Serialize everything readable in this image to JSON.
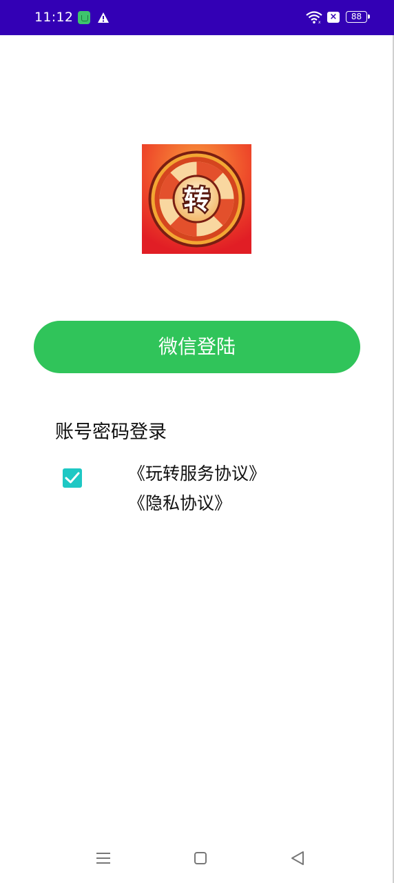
{
  "status_bar": {
    "time": "11:12",
    "battery": "88",
    "icons": [
      "app-notification-icon",
      "warning-icon",
      "wifi-icon",
      "no-sim-icon",
      "battery-icon"
    ]
  },
  "logo": {
    "character": "转",
    "colors": {
      "background": "#e8392a",
      "ring": "#f0a030",
      "center": "#f6d6a8"
    }
  },
  "login": {
    "wechat_button": "微信登陆",
    "account_login": "账号密码登录"
  },
  "agreement": {
    "checked": true,
    "terms": "《玩转服务协议》",
    "privacy": "《隐私协议》"
  },
  "colors": {
    "status_bar": "#3300b5",
    "primary_button": "#30c45a",
    "checkbox": "#1ec8c4"
  },
  "nav_bar": {
    "icons": [
      "menu-icon",
      "home-icon",
      "back-icon"
    ]
  }
}
